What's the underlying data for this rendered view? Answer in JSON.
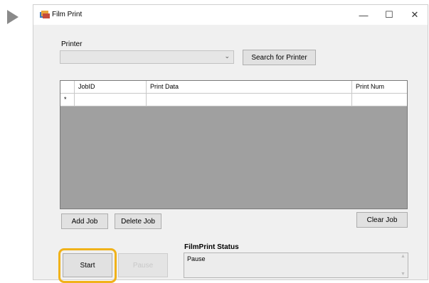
{
  "window": {
    "title": "Film Print",
    "minimize_glyph": "—",
    "maximize_glyph": "☐",
    "close_glyph": "✕"
  },
  "printer": {
    "label": "Printer",
    "selected_value": "",
    "search_button_label": "Search for Printer"
  },
  "grid": {
    "columns": [
      "JobID",
      "Print Data",
      "Print Num"
    ],
    "new_row_marker": "*",
    "rows": [
      {
        "JobID": "",
        "Print Data": "",
        "Print Num": ""
      }
    ]
  },
  "job_buttons": {
    "add": "Add Job",
    "delete": "Delete Job",
    "clear": "Clear Job"
  },
  "controls": {
    "start": "Start",
    "pause": "Pause"
  },
  "status": {
    "label": "FilmPrint Status",
    "text": "Pause"
  },
  "colors": {
    "highlight": "#f0b21a",
    "grid_background": "#a0a0a0",
    "indicator_arrow": "#8a8a8a"
  }
}
